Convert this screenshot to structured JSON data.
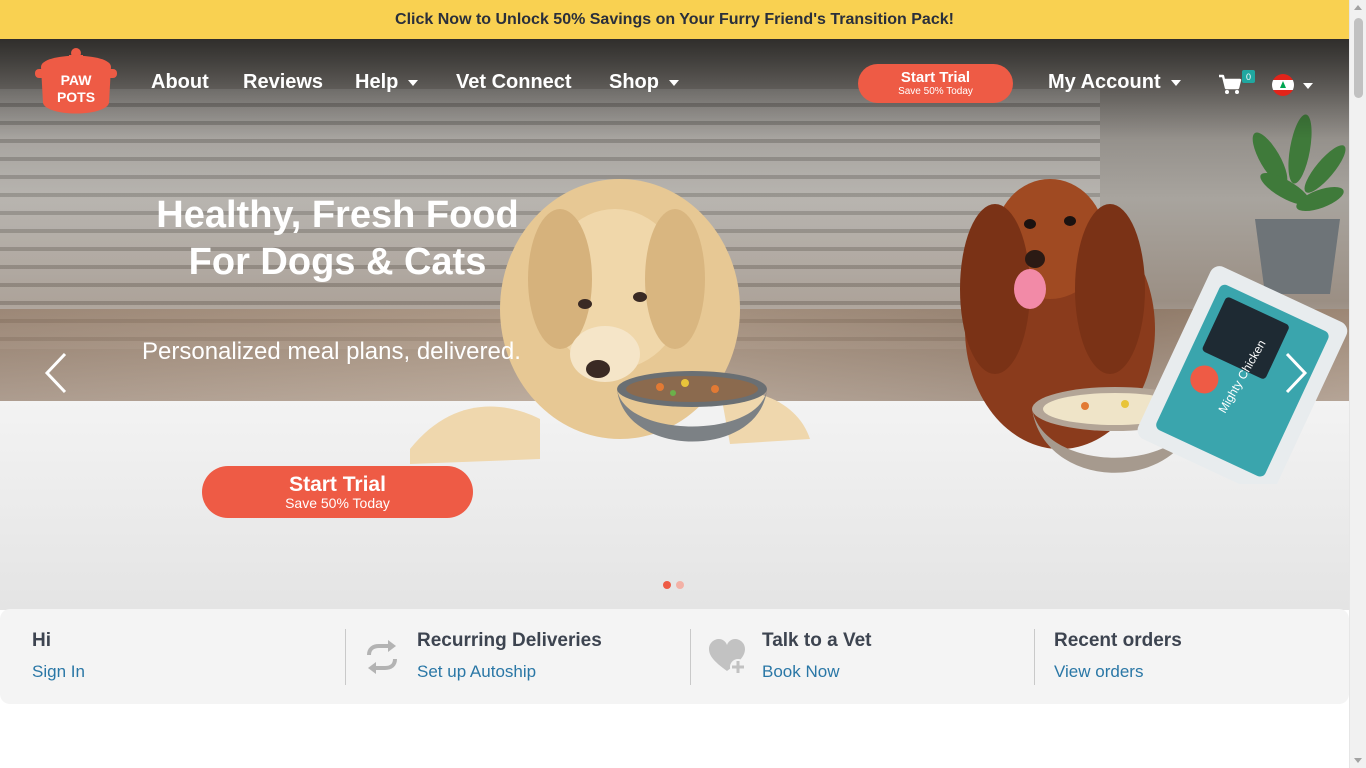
{
  "promo": {
    "text": "Click Now to Unlock 50% Savings on Your Furry Friend's Transition Pack!"
  },
  "brand": {
    "logo_line1": "PAW",
    "logo_line2": "POTS",
    "accent": "#ee5b45",
    "promo_bg": "#f9d151",
    "link_color": "#2a77a6"
  },
  "nav": {
    "about": "About",
    "reviews": "Reviews",
    "help": "Help",
    "vet_connect": "Vet Connect",
    "shop": "Shop",
    "cta_label": "Start Trial",
    "cta_sub": "Save 50% Today",
    "account": "My Account",
    "cart_count": "0"
  },
  "hero": {
    "title_line1": "Healthy, Fresh Food",
    "title_line2": "For Dogs & Cats",
    "subtitle": "Personalized meal plans, delivered.",
    "cta_label": "Start Trial",
    "cta_sub": "Save 50% Today",
    "pack_label": "Mighty Chicken",
    "slides": 2,
    "active_slide": 1
  },
  "info": {
    "greeting": {
      "title": "Hi",
      "link": "Sign In"
    },
    "recurring": {
      "title": "Recurring Deliveries",
      "link": "Set up Autoship",
      "icon": "repeat-icon"
    },
    "vet": {
      "title": "Talk to a Vet",
      "link": "Book Now",
      "icon": "heart-plus-icon"
    },
    "orders": {
      "title": "Recent orders",
      "link": "View orders"
    }
  }
}
